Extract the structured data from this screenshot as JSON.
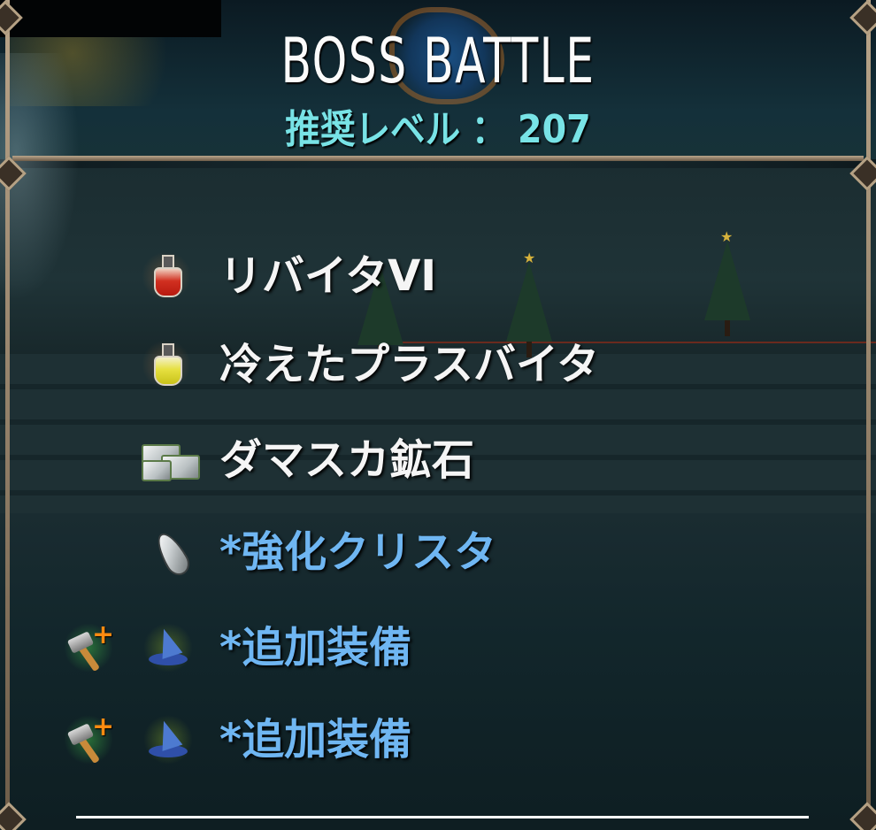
{
  "header": {
    "title": "BOSS BATTLE",
    "level_label": "推奨レベル",
    "level_separator": "：",
    "level_value": "207"
  },
  "rewards": [
    {
      "icon": "red-potion-icon",
      "label": "リバイタVI",
      "style": "normal"
    },
    {
      "icon": "yellow-potion-icon",
      "label": "冷えたプラスバイタ",
      "style": "normal"
    },
    {
      "icon": "ore-ingot-icon",
      "label": "ダマスカ鉱石",
      "style": "normal"
    },
    {
      "icon": "crystal-shard-icon",
      "label": "*強化クリスタ",
      "style": "special"
    },
    {
      "icons": [
        "hammer-plus-icon",
        "wizard-hat-icon"
      ],
      "label": "*追加装備",
      "style": "special"
    },
    {
      "icons": [
        "hammer-plus-icon",
        "wizard-hat-icon"
      ],
      "label": "*追加装備",
      "style": "special"
    }
  ],
  "colors": {
    "title": "#fbfbfb",
    "level": "#78e3e6",
    "item_normal": "#f5f5f5",
    "item_special": "#6fb6f2",
    "frame": "#b5a184"
  }
}
